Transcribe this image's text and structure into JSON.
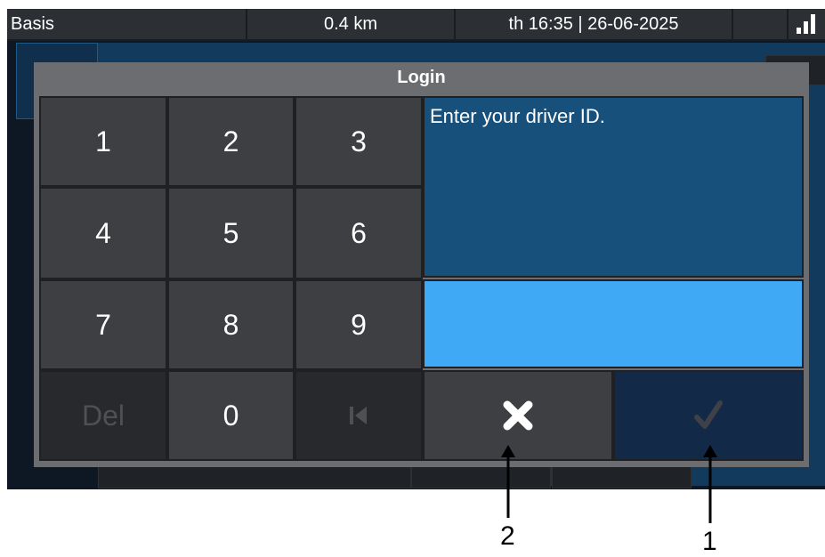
{
  "status_bar": {
    "profile": "Basis",
    "distance": "0.4 km",
    "datetime": "th 16:35 | 26-06-2025"
  },
  "dialog": {
    "title": "Login",
    "prompt": "Enter your driver ID.",
    "entry_value": "",
    "keys": [
      "1",
      "2",
      "3",
      "4",
      "5",
      "6",
      "7",
      "8",
      "9",
      "Del",
      "0"
    ],
    "cancel_icon": "close-icon",
    "confirm_icon": "checkmark-icon"
  },
  "annotations": {
    "label_cancel": "2",
    "label_confirm": "1"
  },
  "colors": {
    "prompt_bg": "#17507b",
    "entry_bg": "#3fa9f5",
    "key_bg": "#3d3f43",
    "confirm_bg": "#122a48"
  }
}
